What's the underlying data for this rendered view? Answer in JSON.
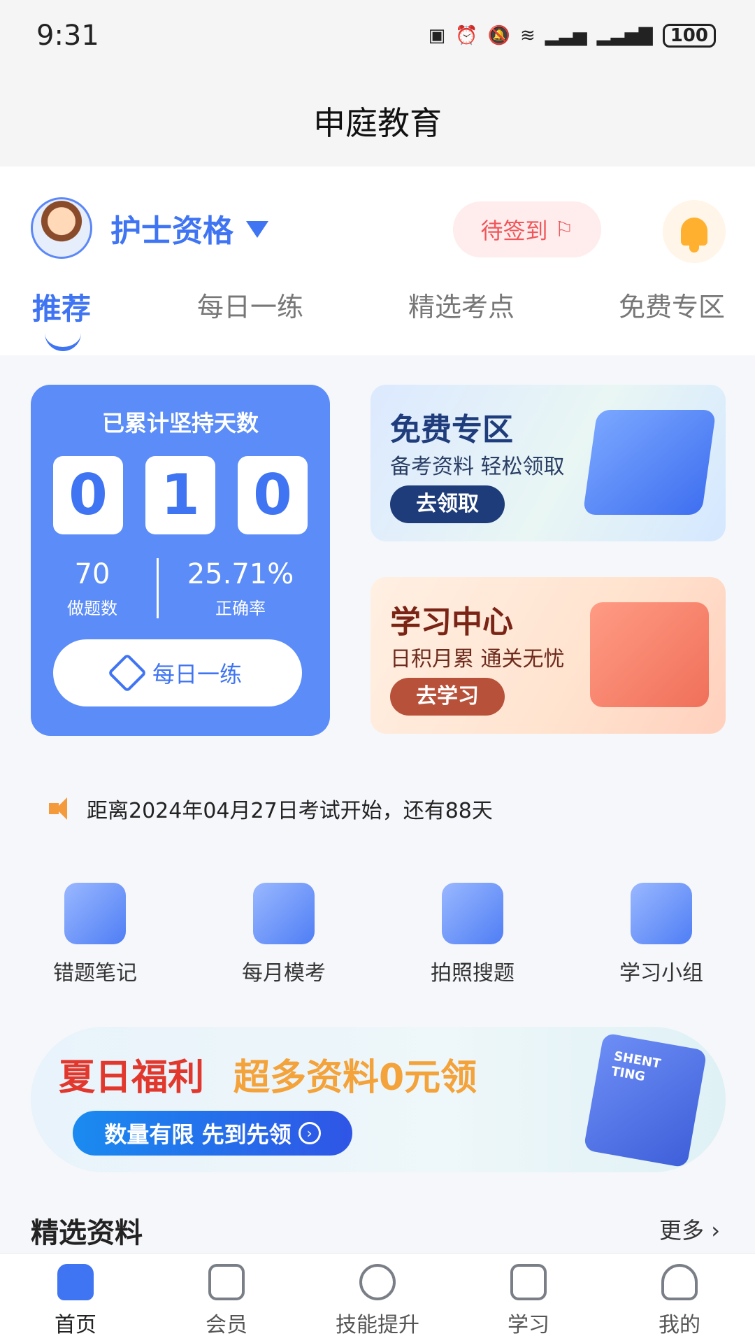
{
  "status_bar": {
    "time": "9:31",
    "icons": [
      "nfc-icon",
      "alarm-icon",
      "mute-icon",
      "wifi-icon",
      "signal-icon",
      "4g-signal-icon"
    ],
    "battery": "100"
  },
  "header": {
    "title": "申庭教育"
  },
  "profile": {
    "cert_label": "护士资格",
    "signin_label": "待签到",
    "colors": {
      "accent": "#3f74f3",
      "signin": "#f0565a"
    }
  },
  "tabs": [
    {
      "label": "推荐",
      "active": true
    },
    {
      "label": "每日一练"
    },
    {
      "label": "精选考点"
    },
    {
      "label": "免费专区"
    }
  ],
  "streak": {
    "title": "已累计坚持天数",
    "digits": [
      "0",
      "1",
      "0"
    ],
    "questions_value": "70",
    "questions_label": "做题数",
    "accuracy_value": "25.71%",
    "accuracy_label": "正确率",
    "button_label": "每日一练"
  },
  "promos": {
    "free": {
      "title": "免费专区",
      "subtitle": "备考资料 轻松领取",
      "button": "去领取"
    },
    "study": {
      "title": "学习中心",
      "subtitle": "日积月累 通关无忧",
      "button": "去学习"
    }
  },
  "notice": {
    "text": "距离2024年04月27日考试开始，还有88天"
  },
  "quick_access": [
    {
      "label": "错题笔记",
      "icon": "notebook-icon"
    },
    {
      "label": "每月模考",
      "icon": "tap-screen-icon"
    },
    {
      "label": "拍照搜题",
      "icon": "camera-search-icon"
    },
    {
      "label": "学习小组",
      "icon": "group-icon"
    }
  ],
  "banner": {
    "title_a": "夏日福利",
    "title_b": "超多资料0元领",
    "pill_text": "数量有限 先到先领",
    "book_text": "SHENT TING"
  },
  "section": {
    "title": "精选资料",
    "more": "更多"
  },
  "bottom_nav": [
    {
      "label": "首页",
      "active": true
    },
    {
      "label": "会员"
    },
    {
      "label": "技能提升"
    },
    {
      "label": "学习"
    },
    {
      "label": "我的"
    }
  ]
}
